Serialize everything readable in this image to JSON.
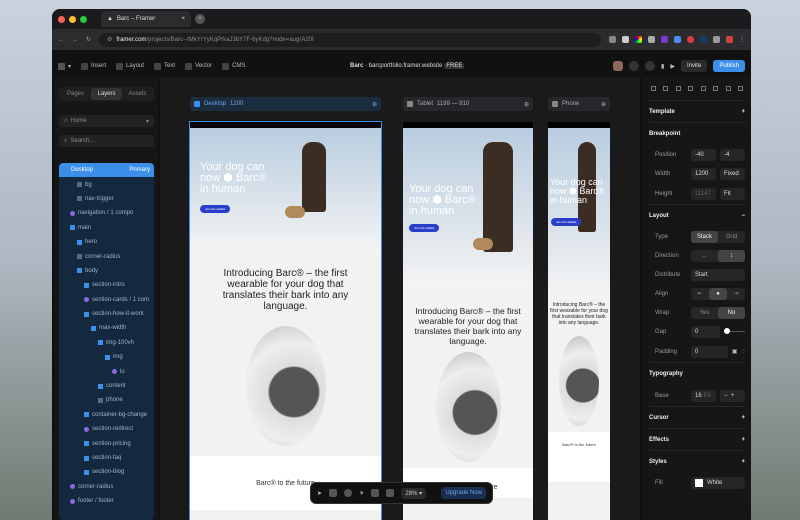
{
  "browser": {
    "tab_title": "Barc – Framer",
    "url_host": "framer.com",
    "url_path": "/projects/Barc--tMkYrYyKqPrkaJ3bY7F-6yKdg?node=augrA20I"
  },
  "toolbar": {
    "items": [
      "Insert",
      "Layout",
      "Text",
      "Vector",
      "CMS"
    ],
    "project_name": "Barc",
    "project_site": "barcportfolio.framer.website",
    "project_tag": "FREE",
    "invite": "Invite",
    "publish": "Publish"
  },
  "left": {
    "tabs": [
      "Pages",
      "Layers",
      "Assets"
    ],
    "page": "Home",
    "search_placeholder": "Search...",
    "layers": [
      {
        "name": "Desktop",
        "badge": "Primary",
        "depth": 0,
        "kind": "frame"
      },
      {
        "name": "bg",
        "depth": 2,
        "kind": "grey"
      },
      {
        "name": "nav-trigger",
        "depth": 2,
        "kind": "grey"
      },
      {
        "name": "navigation / 1 compo",
        "depth": 1,
        "kind": "comp"
      },
      {
        "name": "main",
        "depth": 1,
        "kind": "frame"
      },
      {
        "name": "hero",
        "depth": 2,
        "kind": "frame"
      },
      {
        "name": "corner-radius",
        "depth": 2,
        "kind": "grey"
      },
      {
        "name": "body",
        "depth": 2,
        "kind": "frame"
      },
      {
        "name": "section-intro",
        "depth": 3,
        "kind": "frame"
      },
      {
        "name": "section-cards / 1 com",
        "depth": 3,
        "kind": "comp"
      },
      {
        "name": "section-how-it-work",
        "depth": 3,
        "kind": "frame"
      },
      {
        "name": "max-width",
        "depth": 4,
        "kind": "frame"
      },
      {
        "name": "img-100vh",
        "depth": 5,
        "kind": "frame"
      },
      {
        "name": "img",
        "depth": 6,
        "kind": "frame"
      },
      {
        "name": "lo",
        "depth": 7,
        "kind": "comp"
      },
      {
        "name": "content",
        "depth": 5,
        "kind": "frame"
      },
      {
        "name": "phone",
        "depth": 5,
        "kind": "grey"
      },
      {
        "name": "container-bg-change",
        "depth": 3,
        "kind": "frame"
      },
      {
        "name": "section-redirect",
        "depth": 3,
        "kind": "comp"
      },
      {
        "name": "section-pricing",
        "depth": 3,
        "kind": "frame"
      },
      {
        "name": "section-faq",
        "depth": 3,
        "kind": "frame"
      },
      {
        "name": "section-blog",
        "depth": 3,
        "kind": "frame"
      },
      {
        "name": "corner-radius",
        "depth": 1,
        "kind": "comp"
      },
      {
        "name": "footer / footer",
        "depth": 1,
        "kind": "comp"
      }
    ]
  },
  "canvas": {
    "breakpoints": [
      {
        "name": "Desktop",
        "size": "1200"
      },
      {
        "name": "Tablet",
        "size": "1199 — 810"
      },
      {
        "name": "Phone",
        "size": ""
      }
    ],
    "hero_title": "Your dog can now ⬢ Barc® in human",
    "cta": "Join the waitlist",
    "intro": "Introducing Barc® – the first wearable for your dog that translates their bark into any language.",
    "future": "Barc® to the future",
    "future_tablet": "Barc® to the future",
    "phone_future": "Barc® to the future"
  },
  "dock": {
    "zoom": "28%",
    "upgrade": "Upgrade Now"
  },
  "right": {
    "template": "Template",
    "breakpoint": {
      "title": "Breakpoint",
      "position_label": "Position",
      "pos_x": "-40",
      "pos_y": "-4",
      "width_label": "Width",
      "width": "1200",
      "width_mode": "Fixed",
      "height_label": "Height",
      "height": "11147",
      "height_mode": "Fit"
    },
    "layout": {
      "title": "Layout",
      "type_label": "Type",
      "types": [
        "Stack",
        "Grid"
      ],
      "direction_label": "Direction",
      "distribute_label": "Distribute",
      "distribute": "Start",
      "align_label": "Align",
      "wrap_label": "Wrap",
      "wrap": [
        "Yes",
        "No"
      ],
      "gap_label": "Gap",
      "gap": "0",
      "padding_label": "Padding",
      "padding": "0"
    },
    "typography": {
      "title": "Typography",
      "base_label": "Base",
      "base": "16",
      "unit": "PX"
    },
    "cursor": "Cursor",
    "effects": "Effects",
    "styles": "Styles",
    "fill_label": "Fill",
    "fill": "White"
  },
  "colors": {
    "accent": "#3b8fe8",
    "cta": "#2a3fc9"
  }
}
